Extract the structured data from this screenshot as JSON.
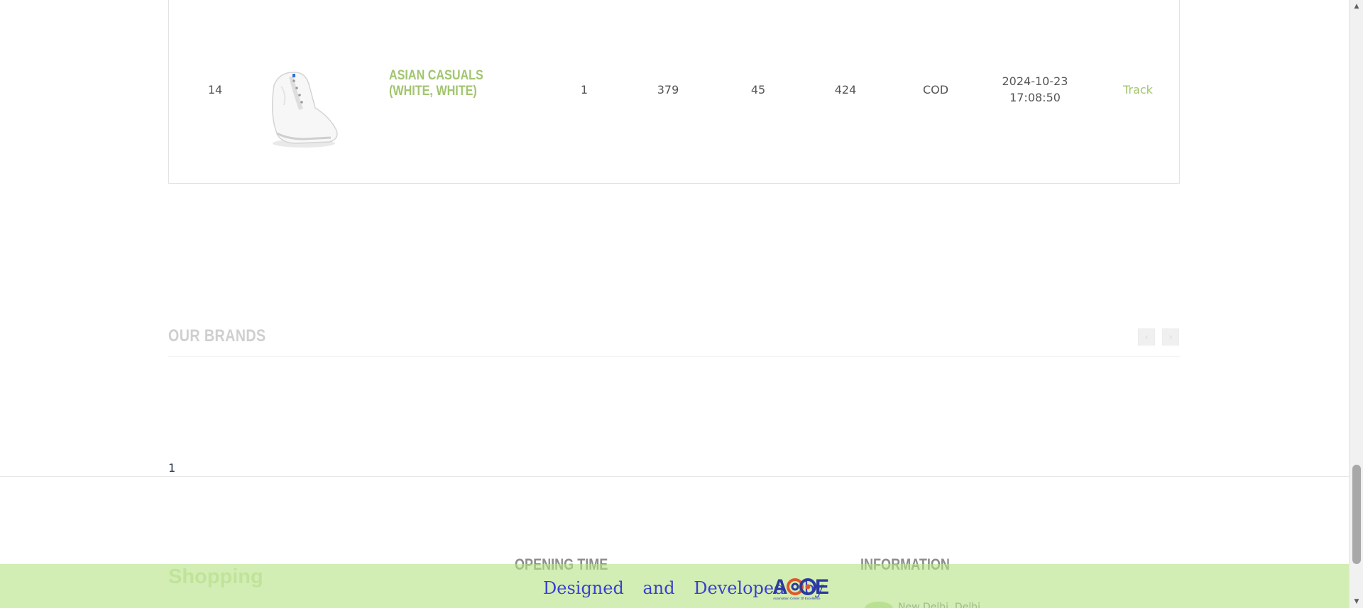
{
  "order": {
    "serial": "14",
    "product_name": "ASIAN CASUALS (WHITE, WHITE)",
    "quantity": "1",
    "price": "379",
    "shipping": "45",
    "total": "424",
    "payment_method": "COD",
    "order_date": "2024-10-23",
    "order_time": "17:08:50",
    "track_label": "Track",
    "product_image": "white-sneaker-image"
  },
  "brands": {
    "title": "OUR BRANDS",
    "prev_icon": "chevron-left-icon",
    "next_icon": "chevron-right-icon"
  },
  "pagination": {
    "current_page": "1"
  },
  "footer": {
    "brand": "Shopping",
    "col_opening_time": "OPENING TIME",
    "col_information": "INFORMATION",
    "address_partial": "New Delhi, Delhi"
  },
  "credit": {
    "text": "Designed and Developed by",
    "logo_text": "ACoE",
    "logo_subtext": "Automation Center of Excellence"
  },
  "colors": {
    "accent_green": "#a1c56f",
    "credit_bar": "#cdebab",
    "credit_text": "#3a3fd0"
  }
}
